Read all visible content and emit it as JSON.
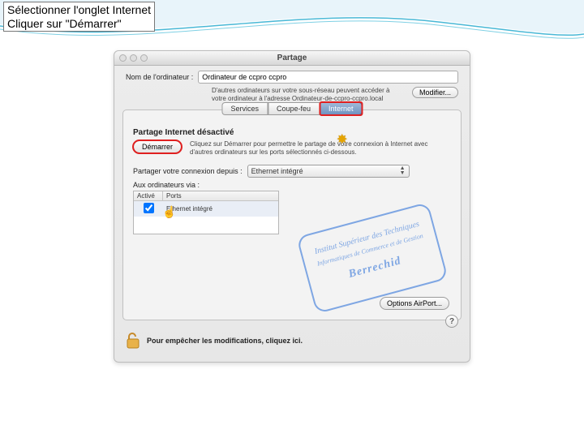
{
  "instructions": {
    "line1": "Sélectionner l'onglet Internet",
    "line2": "Cliquer sur \"Démarrer\""
  },
  "window": {
    "title": "Partage",
    "computer_name_label": "Nom de l'ordinateur :",
    "computer_name_value": "Ordinateur de ccpro ccpro",
    "name_note": "D'autres ordinateurs sur votre sous-réseau peuvent accéder à votre ordinateur à l'adresse Ordinateur-de-ccpro-ccpro.local",
    "modify_button": "Modifier..."
  },
  "tabs": {
    "services": "Services",
    "firewall": "Coupe-feu",
    "internet": "Internet"
  },
  "panel": {
    "status": "Partage Internet désactivé",
    "start_button": "Démarrer",
    "start_hint": "Cliquez sur Démarrer pour permettre le partage de votre connexion à Internet avec d'autres ordinateurs sur les ports sélectionnés ci-dessous.",
    "share_from_label": "Partager votre connexion depuis :",
    "share_from_value": "Ethernet intégré",
    "share_to_label": "Aux ordinateurs via :",
    "table": {
      "col_active": "Activé",
      "col_ports": "Ports",
      "rows": [
        {
          "active": true,
          "port": "Ethernet intégré"
        }
      ]
    },
    "airport_button": "Options AirPort..."
  },
  "lock_text": "Pour empêcher les modifications, cliquez ici.",
  "help_symbol": "?",
  "stamp": {
    "line1": "Institut Supérieur des Techniques",
    "line2": "Informatiques de Commerce et de Gestion",
    "line3": "Berrechid"
  }
}
